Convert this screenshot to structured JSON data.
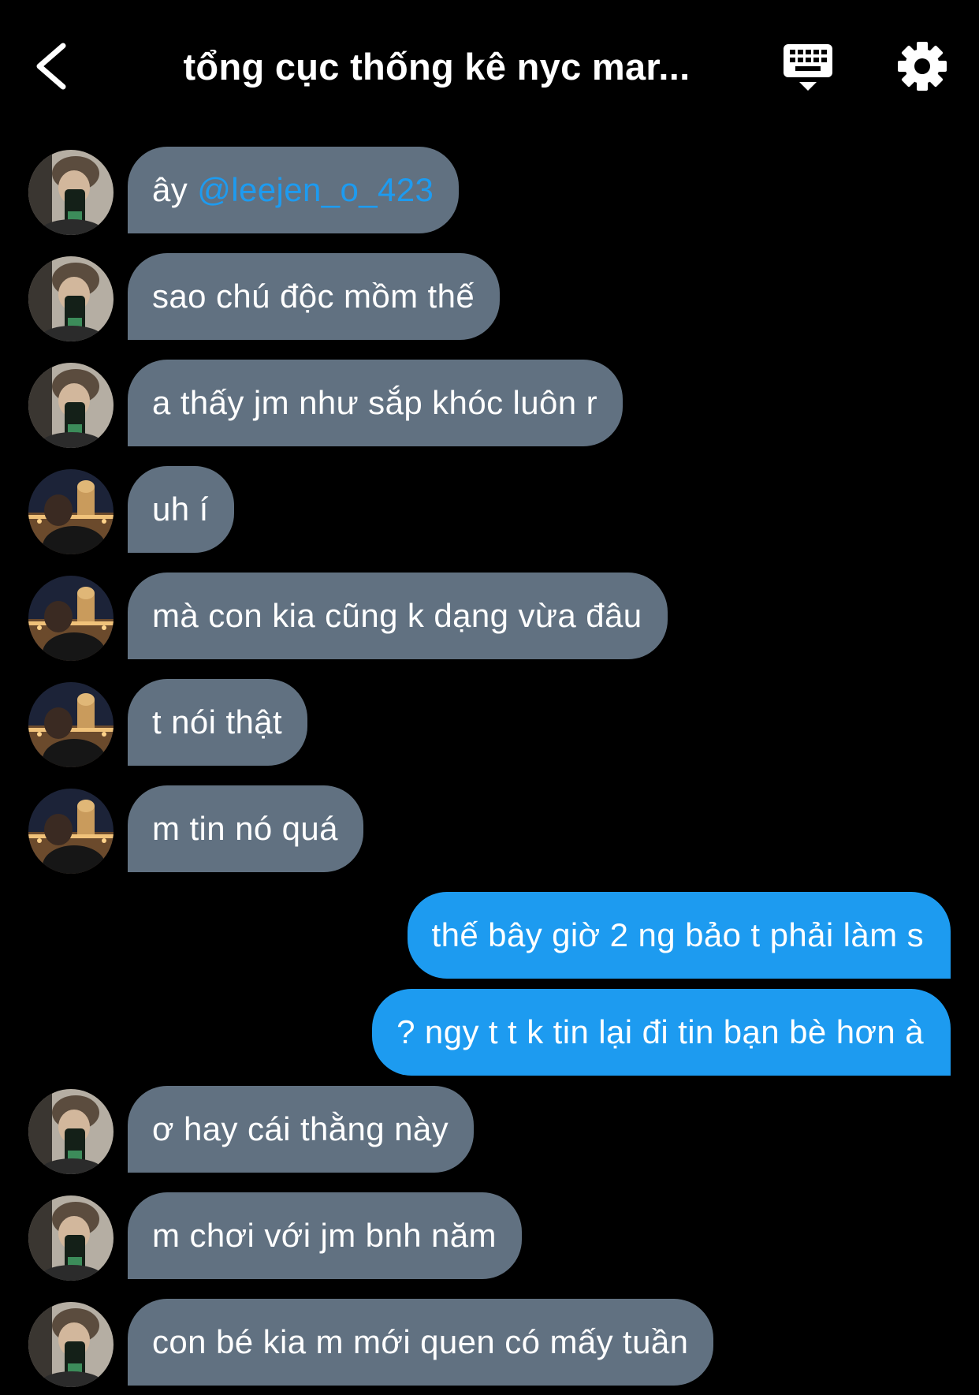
{
  "header": {
    "title": "tổng cục thống kê nyc mar...",
    "back_icon": "chevron-left-icon",
    "keyboard_icon": "keyboard-icon",
    "settings_icon": "gear-icon"
  },
  "colors": {
    "background": "#000000",
    "incoming_bubble": "#617181",
    "outgoing_bubble": "#1d9bf0",
    "mention": "#1d9bf0"
  },
  "messages": [
    {
      "side": "in",
      "avatar": "avatar-phone-selfie",
      "prefix": "ây ",
      "mention": "@leejen_o_423",
      "text": ""
    },
    {
      "side": "in",
      "avatar": "avatar-phone-selfie",
      "text": "sao chú độc mồm thế"
    },
    {
      "side": "in",
      "avatar": "avatar-phone-selfie",
      "text": "a thấy jm như sắp khóc luôn r"
    },
    {
      "side": "in",
      "avatar": "avatar-night-city",
      "text": "uh í"
    },
    {
      "side": "in",
      "avatar": "avatar-night-city",
      "text": "mà con kia cũng k dạng vừa đâu"
    },
    {
      "side": "in",
      "avatar": "avatar-night-city",
      "text": "t nói thật"
    },
    {
      "side": "in",
      "avatar": "avatar-night-city",
      "text": "m tin nó quá"
    },
    {
      "side": "out",
      "text": "thế bây giờ 2 ng bảo t phải làm s"
    },
    {
      "side": "out",
      "text": "? ngy t t k tin lại đi tin bạn bè hơn à"
    },
    {
      "side": "in",
      "avatar": "avatar-phone-selfie",
      "text": "ơ hay cái thằng này"
    },
    {
      "side": "in",
      "avatar": "avatar-phone-selfie",
      "text": "m chơi với jm bnh năm"
    },
    {
      "side": "in",
      "avatar": "avatar-phone-selfie",
      "text": "con bé kia m mới quen có mấy tuần"
    }
  ]
}
